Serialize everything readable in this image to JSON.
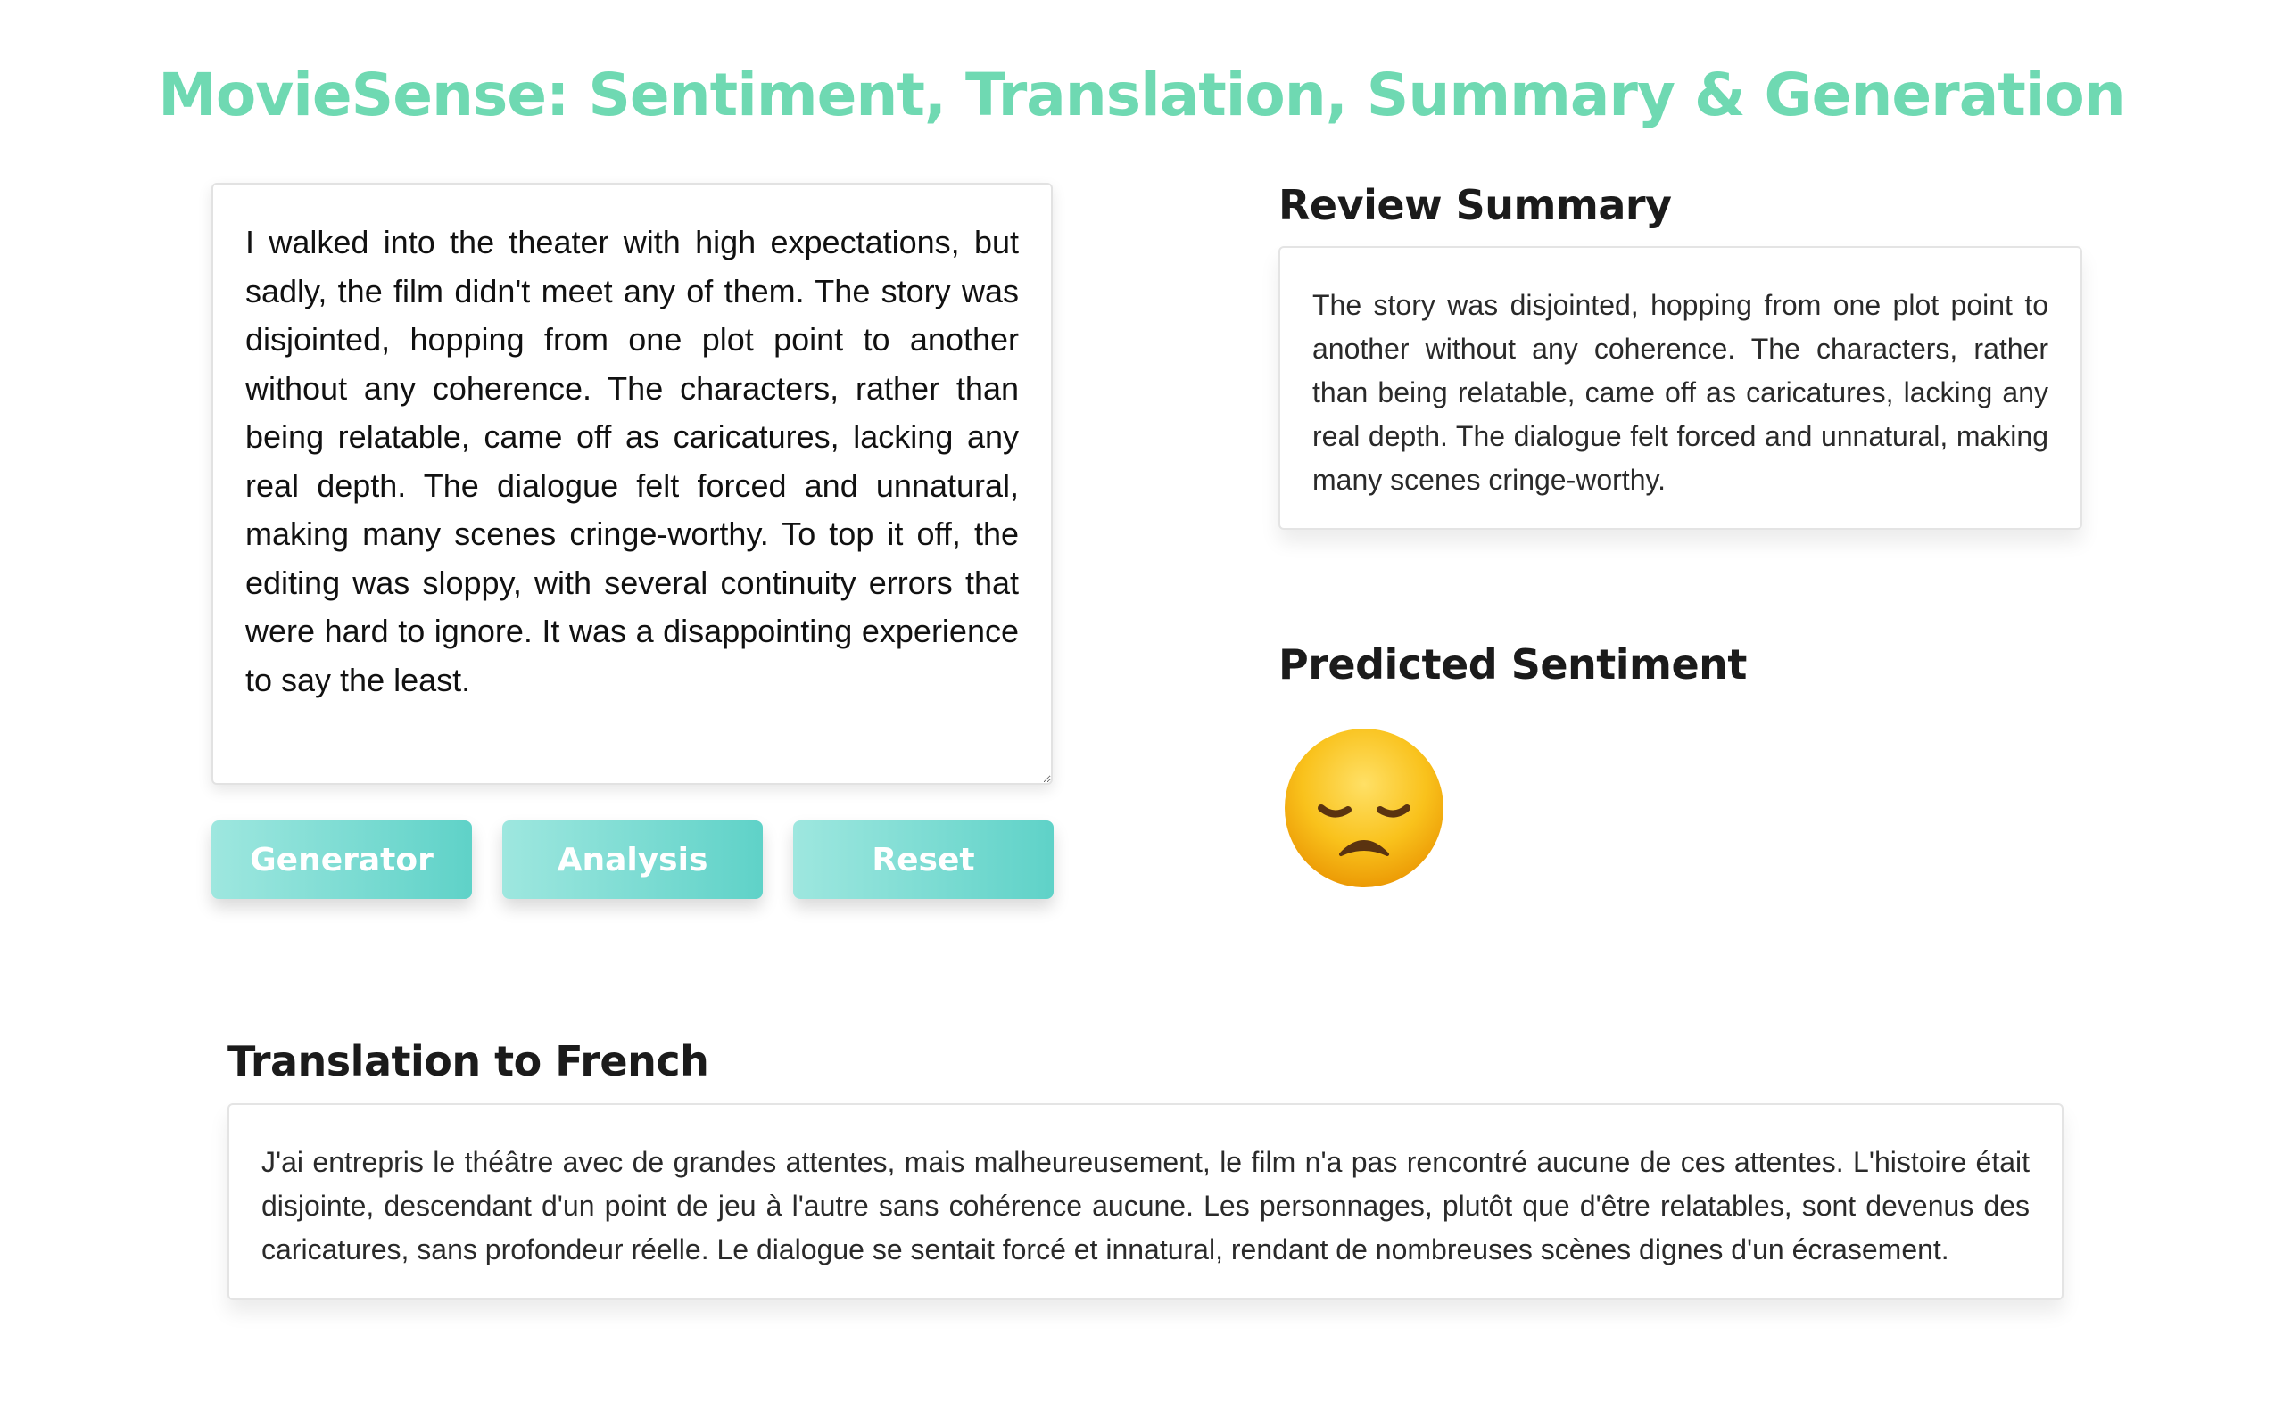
{
  "app": {
    "title": "MovieSense: Sentiment, Translation, Summary & Generation"
  },
  "review_input": {
    "value": "I walked into the theater with high expectations, but sadly, the film didn't meet any of them. The story was disjointed, hopping from one plot point to another without any coherence. The characters, rather than being relatable, came off as caricatures, lacking any real depth. The dialogue felt forced and unnatural, making many scenes cringe-worthy. To top it off, the editing was sloppy, with several continuity errors that were hard to ignore. It was a disappointing experience to say the least."
  },
  "buttons": {
    "generator_label": "Generator",
    "analysis_label": "Analysis",
    "reset_label": "Reset"
  },
  "summary": {
    "heading": "Review Summary",
    "text": "The story was disjointed, hopping from one plot point to another without any coherence. The characters, rather than being relatable, came off as caricatures, lacking any real depth. The dialogue felt forced and unnatural, making many scenes cringe-worthy."
  },
  "sentiment": {
    "heading": "Predicted Sentiment",
    "icon": "disappointed-face-icon"
  },
  "translation": {
    "heading": "Translation to French",
    "text": "J'ai entrepris le théâtre avec de grandes attentes, mais malheureusement, le film n'a pas rencontré aucune de ces attentes. L'histoire était disjointe, descendant d'un point de jeu à l'autre sans cohérence aucune. Les personnages, plutôt que d'être relatables, sont devenus des caricatures, sans profondeur réelle. Le dialogue se sentait forcé et innatural, rendant de nombreuses scènes dignes d'un écrasement."
  },
  "colors": {
    "title": "#6fd9b2",
    "button_gradient_start": "#9ee7df",
    "button_gradient_end": "#5fd2c8",
    "emoji_face": "#f7b500"
  }
}
